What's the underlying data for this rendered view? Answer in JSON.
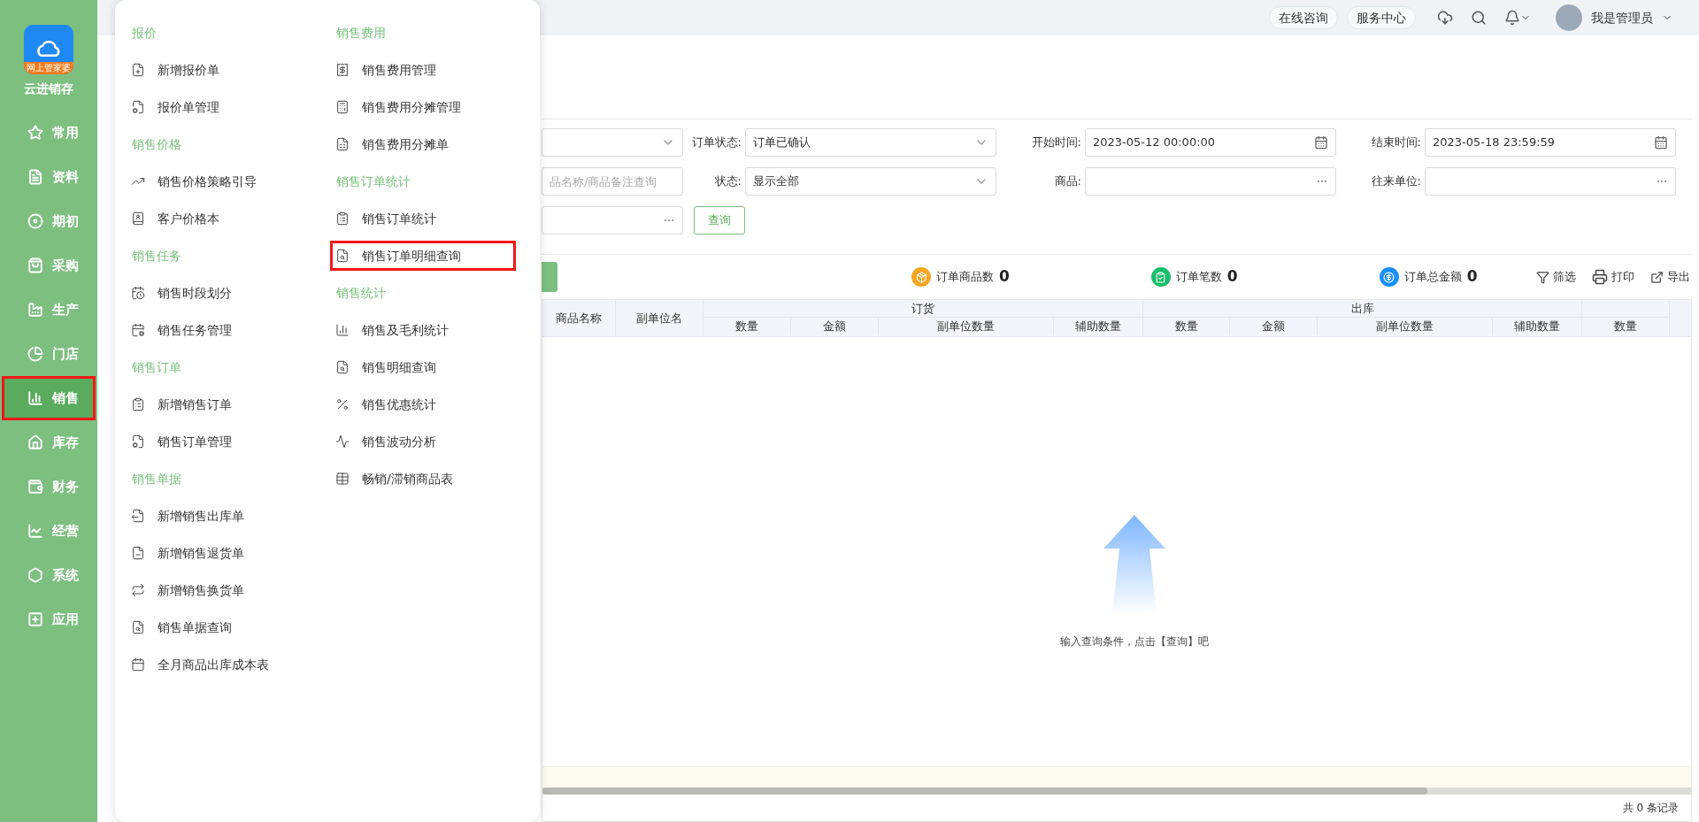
{
  "brand": {
    "badge": "网上管家婆",
    "name": "云进销存"
  },
  "sidebar": {
    "items": [
      {
        "label": "常用",
        "selected": false,
        "highlighted": false
      },
      {
        "label": "资料",
        "selected": false,
        "highlighted": false
      },
      {
        "label": "期初",
        "selected": false,
        "highlighted": false
      },
      {
        "label": "采购",
        "selected": false,
        "highlighted": false
      },
      {
        "label": "生产",
        "selected": false,
        "highlighted": false
      },
      {
        "label": "门店",
        "selected": false,
        "highlighted": false
      },
      {
        "label": "销售",
        "selected": true,
        "highlighted": true
      },
      {
        "label": "库存",
        "selected": false,
        "highlighted": false
      },
      {
        "label": "财务",
        "selected": false,
        "highlighted": false
      },
      {
        "label": "经营",
        "selected": false,
        "highlighted": false
      },
      {
        "label": "系统",
        "selected": false,
        "highlighted": false
      },
      {
        "label": "应用",
        "selected": false,
        "highlighted": false
      }
    ]
  },
  "menu": {
    "columns": [
      {
        "groups": [
          {
            "title": "报价",
            "items": [
              {
                "label": "新增报价单",
                "highlighted": false
              },
              {
                "label": "报价单管理",
                "highlighted": false
              }
            ]
          },
          {
            "title": "销售价格",
            "items": [
              {
                "label": "销售价格策略引导",
                "highlighted": false
              },
              {
                "label": "客户价格本",
                "highlighted": false
              }
            ]
          },
          {
            "title": "销售任务",
            "items": [
              {
                "label": "销售时段划分",
                "highlighted": false
              },
              {
                "label": "销售任务管理",
                "highlighted": false
              }
            ]
          },
          {
            "title": "销售订单",
            "items": [
              {
                "label": "新增销售订单",
                "highlighted": false
              },
              {
                "label": "销售订单管理",
                "highlighted": false
              }
            ]
          },
          {
            "title": "销售单据",
            "items": [
              {
                "label": "新增销售出库单",
                "highlighted": false
              },
              {
                "label": "新增销售退货单",
                "highlighted": false
              },
              {
                "label": "新增销售换货单",
                "highlighted": false
              },
              {
                "label": "销售单据查询",
                "highlighted": false
              },
              {
                "label": "全月商品出库成本表",
                "highlighted": false
              }
            ]
          }
        ]
      },
      {
        "groups": [
          {
            "title": "销售费用",
            "items": [
              {
                "label": "销售费用管理",
                "highlighted": false
              },
              {
                "label": "销售费用分摊管理",
                "highlighted": false
              },
              {
                "label": "销售费用分摊单",
                "highlighted": false
              }
            ]
          },
          {
            "title": "销售订单统计",
            "items": [
              {
                "label": "销售订单统计",
                "highlighted": false
              },
              {
                "label": "销售订单明细查询",
                "highlighted": true
              }
            ]
          },
          {
            "title": "销售统计",
            "items": [
              {
                "label": "销售及毛利统计",
                "highlighted": false
              },
              {
                "label": "销售明细查询",
                "highlighted": false
              },
              {
                "label": "销售优惠统计",
                "highlighted": false
              },
              {
                "label": "销售波动分析",
                "highlighted": false
              },
              {
                "label": "畅销/滞销商品表",
                "highlighted": false
              }
            ]
          }
        ]
      }
    ]
  },
  "topbar": {
    "links": [
      "在线咨询",
      "服务中心"
    ],
    "user": "我是管理员"
  },
  "filters": [
    {
      "kind": "select"
    },
    {
      "kind": "select",
      "label": "订单状态:",
      "value": "订单已确认"
    },
    {
      "kind": "date",
      "label": "开始时间:",
      "value": "2023-05-12 00:00:00"
    },
    {
      "kind": "date",
      "label": "结束时间:",
      "value": "2023-05-18 23:59:59"
    },
    {
      "kind": "text",
      "placeholder": "品名称/商品备注查询"
    },
    {
      "kind": "select",
      "label": "状态:",
      "value": "显示全部"
    },
    {
      "kind": "picker",
      "label": "商品:"
    },
    {
      "kind": "picker",
      "label": "往来单位:"
    },
    {
      "kind": "picker"
    },
    {
      "kind": "button",
      "label": "查询"
    }
  ],
  "summary": [
    {
      "label": "订单商品数",
      "value": "0",
      "color": "#f5a623"
    },
    {
      "label": "订单笔数",
      "value": "0",
      "color": "#19be6b"
    },
    {
      "label": "订单总金额",
      "value": "0",
      "color": "#1890ff"
    }
  ],
  "actions": [
    "筛选",
    "打印",
    "导出"
  ],
  "table": {
    "columns": [
      {
        "label": "商品名称"
      },
      {
        "label": "副单位名"
      },
      {
        "label": "订货",
        "children": [
          "数量",
          "金额",
          "副单位数量",
          "辅助数量"
        ]
      },
      {
        "label": "出库",
        "children": [
          "数量",
          "金额",
          "副单位数量",
          "辅助数量"
        ]
      },
      {
        "children": [
          "数量"
        ]
      }
    ],
    "empty_message": "输入查询条件，点击【查询】吧"
  },
  "footer": {
    "count": "共 0 条记录"
  }
}
